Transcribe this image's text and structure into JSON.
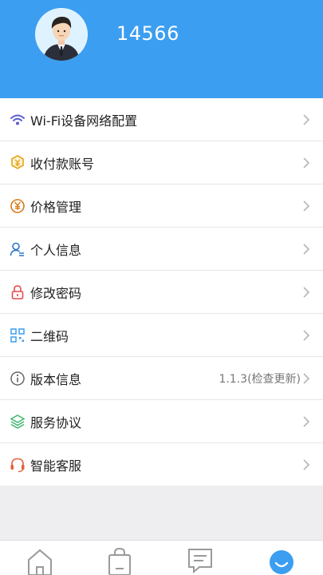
{
  "profile": {
    "user_id": "14566",
    "avatar_icon": "user-avatar-icon"
  },
  "menu": {
    "items": [
      {
        "label": "Wi-Fi设备网络配置",
        "icon": "wifi-icon",
        "icon_color": "#5a5ecc"
      },
      {
        "label": "收付款账号",
        "icon": "payment-account-icon",
        "icon_color": "#e8a316"
      },
      {
        "label": "价格管理",
        "icon": "yuan-icon",
        "icon_color": "#d97a1a"
      },
      {
        "label": "个人信息",
        "icon": "person-info-icon",
        "icon_color": "#2c77c9"
      },
      {
        "label": "修改密码",
        "icon": "lock-icon",
        "icon_color": "#e24b4b"
      },
      {
        "label": "二维码",
        "icon": "qr-code-icon",
        "icon_color": "#3b9ef0"
      },
      {
        "label": "版本信息",
        "icon": "info-icon",
        "icon_color": "#666666",
        "value": "1.1.3(检查更新)"
      },
      {
        "label": "服务协议",
        "icon": "layers-icon",
        "icon_color": "#3fb66f"
      },
      {
        "label": "智能客服",
        "icon": "headset-icon",
        "icon_color": "#e2613c"
      }
    ]
  },
  "tabbar": {
    "tabs": [
      {
        "icon": "home-icon"
      },
      {
        "icon": "shopping-bag-icon"
      },
      {
        "icon": "message-icon"
      },
      {
        "icon": "profile-icon",
        "active": true
      }
    ]
  },
  "colors": {
    "header_bg": "#3b9ef0",
    "accent": "#3b9ef0",
    "page_bg": "#eeeef0"
  }
}
